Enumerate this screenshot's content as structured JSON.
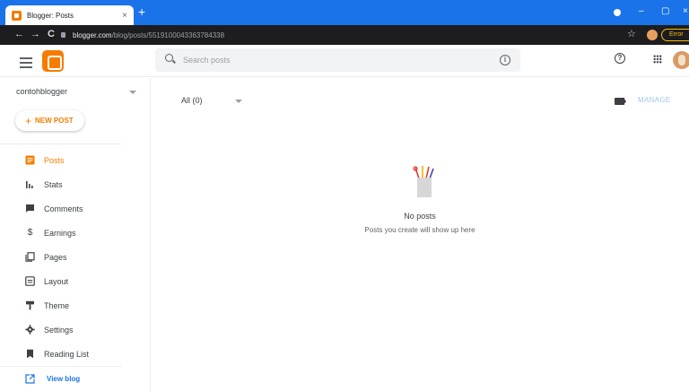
{
  "browser": {
    "tab_title": "Blogger: Posts",
    "tab_close": "×",
    "new_tab": "+",
    "url_host": "blogger.com",
    "url_path": "/blog/posts/5519100043363784338",
    "error_label": "Error",
    "back": "←",
    "forward": "→",
    "reload": "C",
    "star": "☆",
    "minimize": "–",
    "maximize": "▢",
    "close": "×"
  },
  "header": {
    "search_placeholder": "Search posts",
    "info_glyph": "i",
    "help_glyph": "?"
  },
  "sidebar": {
    "blog_name": "contohblogger",
    "new_post_plus": "+",
    "new_post_label": "NEW POST",
    "items": [
      {
        "label": "Posts",
        "icon": "posts-icon",
        "active": true
      },
      {
        "label": "Stats",
        "icon": "stats-icon"
      },
      {
        "label": "Comments",
        "icon": "comments-icon"
      },
      {
        "label": "Earnings",
        "icon": "dollar-icon"
      },
      {
        "label": "Pages",
        "icon": "pages-icon"
      },
      {
        "label": "Layout",
        "icon": "layout-icon"
      },
      {
        "label": "Theme",
        "icon": "theme-icon"
      },
      {
        "label": "Settings",
        "icon": "gear-icon"
      },
      {
        "label": "Reading List",
        "icon": "bookmark-icon"
      }
    ],
    "view_blog_label": "View blog"
  },
  "main": {
    "filter_label": "All (0)",
    "manage_label": "MANAGE",
    "empty_title": "No posts",
    "empty_subtitle": "Posts you create will show up here"
  },
  "colors": {
    "accent": "#f57c00",
    "chrome_blue": "#1a73e8",
    "link": "#1a73e8"
  }
}
